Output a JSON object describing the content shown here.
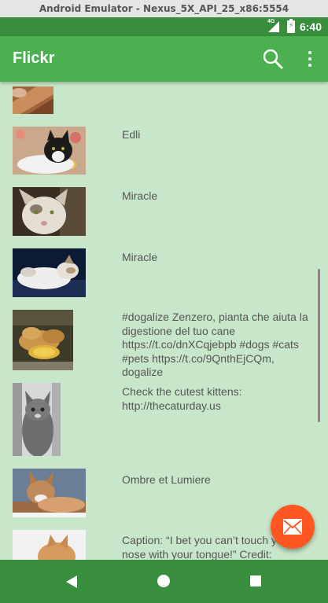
{
  "window": {
    "title": "Android Emulator - Nexus_5X_API_25_x86:5554"
  },
  "status_bar": {
    "network": "4G",
    "battery_glyph": "⚡",
    "time": "6:40"
  },
  "app_bar": {
    "title": "Flickr",
    "search_icon": "search-icon",
    "overflow_icon": "more-vert-icon"
  },
  "photos": [
    {
      "caption": ""
    },
    {
      "caption": "Edli"
    },
    {
      "caption": "Miracle"
    },
    {
      "caption": "Miracle"
    },
    {
      "caption": "#dogalize Zenzero, pianta che aiuta la digestione del tuo cane https://t.co/dnXCqjebpb #dogs #cats #pets https://t.co/9QnthEjCQm, dogalize"
    },
    {
      "caption": "Check the cutest kittens: http://thecaturday.us"
    },
    {
      "caption": "Ombre et Lumiere"
    },
    {
      "caption": "Caption: “I bet you can’t touch your nose with your tongue!” Credit:"
    }
  ],
  "fab": {
    "icon": "mail-icon"
  },
  "nav_bar": {
    "back": "back-icon",
    "home": "home-icon",
    "recents": "recents-icon"
  },
  "colors": {
    "primary": "#4caf50",
    "primary_dark": "#388e3c",
    "background": "#c8e6c9",
    "accent": "#ff5722"
  }
}
